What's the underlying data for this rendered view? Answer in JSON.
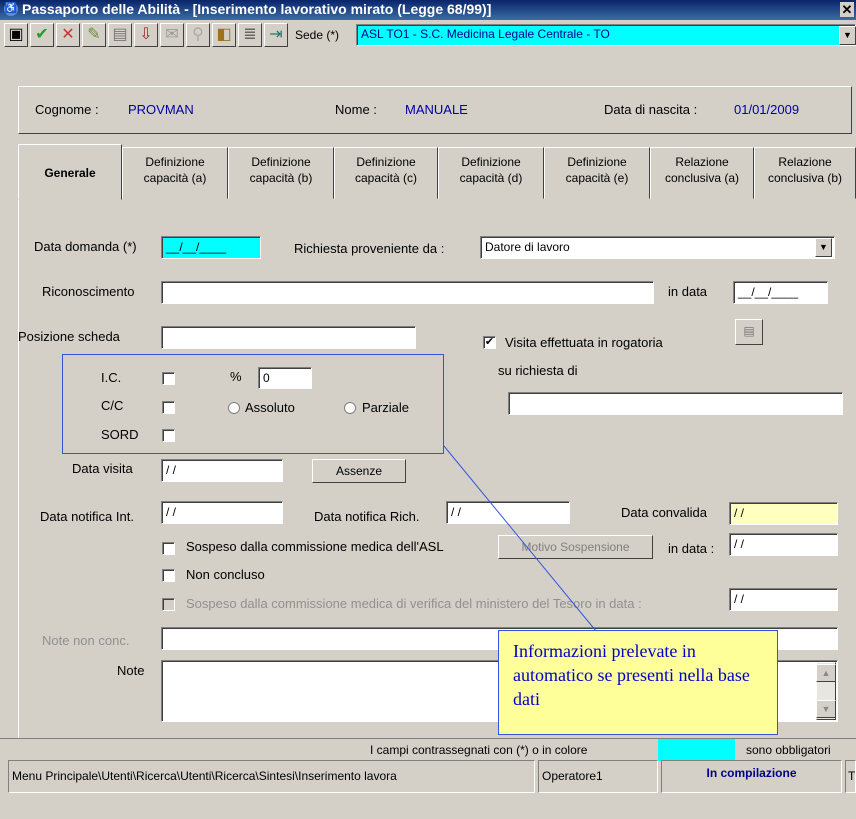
{
  "window": {
    "title": "Passaporto delle Abilità - [Inserimento lavorativo mirato  (Legge 68/99)]",
    "close_glyph": "✕"
  },
  "toolbar": {
    "icons": [
      "save-icon",
      "confirm-icon",
      "cancel-icon",
      "tools-icon",
      "print-icon",
      "import-icon",
      "mail-icon",
      "search-icon",
      "attachment-icon",
      "document-icon",
      "exit-icon"
    ],
    "sede_label": "Sede (*)",
    "sede_value": "ASL TO1 - S.C. Medicina Legale Centrale - TO"
  },
  "person": {
    "cognome_label": "Cognome :",
    "cognome_value": "PROVMAN",
    "nome_label": "Nome :",
    "nome_value": "MANUALE",
    "nascita_label": "Data di nascita :",
    "nascita_value": "01/01/2009"
  },
  "tabs": [
    {
      "line1": "Generale",
      "line2": ""
    },
    {
      "line1": "Definizione",
      "line2": "capacità (a)"
    },
    {
      "line1": "Definizione",
      "line2": "capacità (b)"
    },
    {
      "line1": "Definizione",
      "line2": "capacità (c)"
    },
    {
      "line1": "Definizione",
      "line2": "capacità (d)"
    },
    {
      "line1": "Definizione",
      "line2": "capacità (e)"
    },
    {
      "line1": "Relazione",
      "line2": "conclusiva (a)"
    },
    {
      "line1": "Relazione",
      "line2": "conclusiva (b)"
    }
  ],
  "form": {
    "data_domanda_label": "Data domanda (*)",
    "data_domanda_value": "__/__/____",
    "richiesta_label": "Richiesta proveniente da :",
    "richiesta_value": "Datore di lavoro",
    "riconoscimento_label": "Riconoscimento",
    "in_data_label": "in data",
    "in_data_value": "__/__/____",
    "posizione_label": "Posizione scheda",
    "visita_rogatoria_label": "Visita effettuata in rogatoria",
    "su_richiesta_label": "su richiesta di",
    "ic_label": "I.C.",
    "percent_label": "%",
    "percent_value": "0",
    "cc_label": "C/C",
    "assoluto_label": "Assoluto",
    "parziale_label": "Parziale",
    "sord_label": "SORD",
    "data_visita_label": "Data visita",
    "data_visita_value": "/ /",
    "assenze_button": "Assenze",
    "notifica_int_label": "Data notifica Int.",
    "notifica_int_value": "/ /",
    "notifica_rich_label": "Data notifica Rich.",
    "notifica_rich_value": "/ /",
    "convalida_label": "Data convalida",
    "convalida_value": "/ /",
    "sospeso_asl_label": "Sospeso dalla commissione medica dell'ASL",
    "motivo_button": "Motivo Sospensione",
    "in_data2_label": "in data :",
    "in_data2_value": "/ /",
    "non_concluso_label": "Non concluso",
    "sospeso_tesoro_label": "Sospeso dalla commissione medica di verifica del ministero del Tesoro in data :",
    "sospeso_tesoro_value": "/ /",
    "note_non_conc_label": "Note non conc.",
    "note_label": "Note"
  },
  "callout": {
    "text": "Informazioni prelevate in automatico se presenti nella base dati"
  },
  "footer": {
    "mandatory_text": "I campi contrassegnati con (*) o in colore",
    "mandatory_suffix": "sono obbligatori"
  },
  "statusbar": {
    "path": "Menu Principale\\Utenti\\Ricerca\\Utenti\\Ricerca\\Sintesi\\Inserimento lavora",
    "operator": "Operatore1",
    "state": "In compilazione",
    "extra": "T"
  },
  "colors": {
    "mandatory": "#00ffff",
    "convalida": "#ffffc0",
    "callout_bg": "#ffff99",
    "callout_text": "#0000cc"
  }
}
